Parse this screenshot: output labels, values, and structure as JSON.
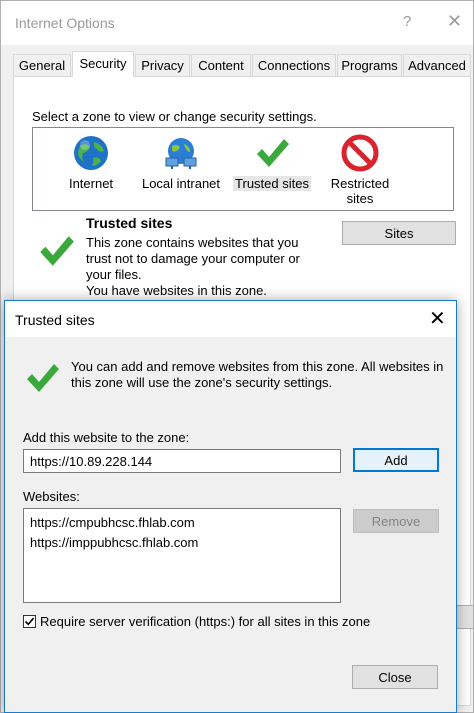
{
  "back_window": {
    "title": "Internet Options",
    "help": "?",
    "close": "✕",
    "tabs": [
      {
        "label": "General"
      },
      {
        "label": "Security"
      },
      {
        "label": "Privacy"
      },
      {
        "label": "Content"
      },
      {
        "label": "Connections"
      },
      {
        "label": "Programs"
      },
      {
        "label": "Advanced"
      }
    ],
    "active_tab": "Security",
    "zone_prompt": "Select a zone to view or change security settings.",
    "zones": [
      {
        "label": "Internet",
        "icon": "globe-icon"
      },
      {
        "label": "Local intranet",
        "icon": "network-icon"
      },
      {
        "label": "Trusted sites",
        "icon": "checkmark-icon"
      },
      {
        "label": "Restricted sites",
        "icon": "prohibited-icon"
      }
    ],
    "selected_zone": "Trusted sites",
    "zone_title": "Trusted sites",
    "zone_desc_lines": [
      "This zone contains websites that you",
      "trust not to damage your computer or",
      "your files.",
      "You have websites in this zone."
    ],
    "sites_button": "Sites"
  },
  "dialog": {
    "title": "Trusted sites",
    "close": "✕",
    "info_text": "You can add and remove websites from this zone. All websites in this zone will use the zone's security settings.",
    "add_label": "Add this website to the zone:",
    "add_value": "https://10.89.228.144",
    "add_button": "Add",
    "websites_label": "Websites:",
    "websites": [
      "https://cmpubhcsc.fhlab.com",
      "https://imppubhcsc.fhlab.com"
    ],
    "remove_button": "Remove",
    "verify_label": "Require server verification (https:) for all sites in this zone",
    "verify_checked": true,
    "close_button": "Close"
  },
  "colors": {
    "accent": "#0078d7",
    "check_green": "#3aa83a",
    "prohibited_red": "#d9232e"
  }
}
